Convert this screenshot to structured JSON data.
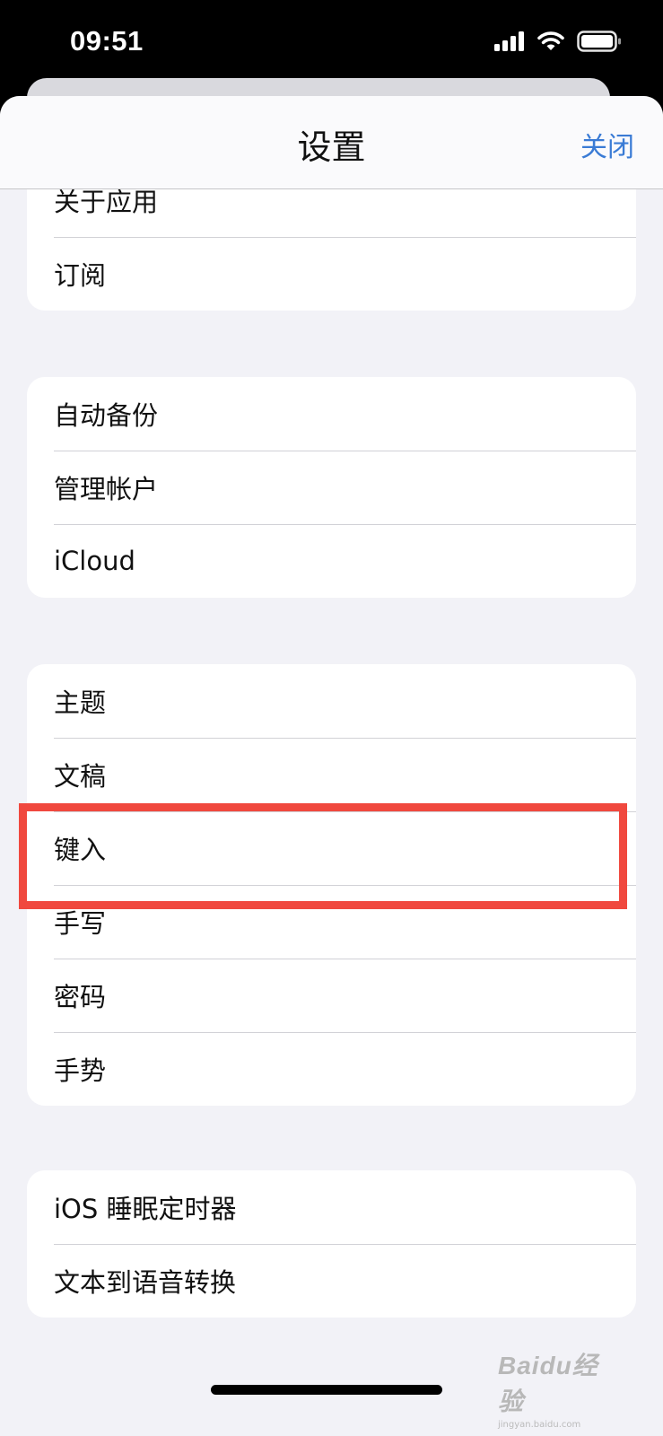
{
  "status_bar": {
    "time": "09:51",
    "icons": [
      "cellular-signal-icon",
      "wifi-icon",
      "battery-icon"
    ]
  },
  "nav": {
    "title": "设置",
    "close_label": "关闭"
  },
  "groups": [
    {
      "items": [
        "关于应用",
        "订阅"
      ]
    },
    {
      "items": [
        "自动备份",
        "管理帐户",
        "iCloud"
      ]
    },
    {
      "items": [
        "主题",
        "文稿",
        "键入",
        "手写",
        "密码",
        "手势"
      ]
    },
    {
      "items": [
        "iOS 睡眠定时器",
        "文本到语音转换"
      ]
    }
  ],
  "annotation": {
    "highlighted_item": "键入",
    "color": "#f0483e"
  },
  "watermark": {
    "text": "Baidu经验",
    "sub": "jingyan.baidu.com"
  },
  "colors": {
    "accent": "#3a7bd5",
    "background": "#f2f2f7"
  }
}
